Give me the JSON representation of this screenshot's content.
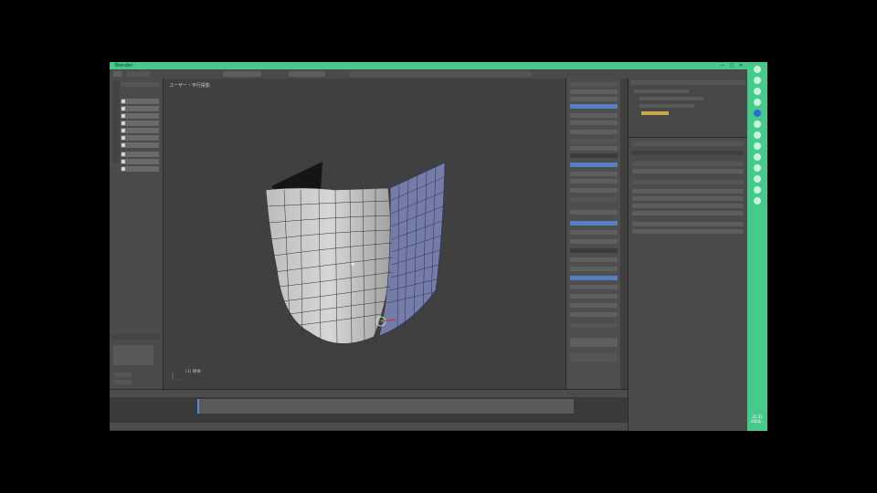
{
  "app": {
    "title": "Blender",
    "win_controls": [
      "—",
      "□",
      "✕"
    ]
  },
  "viewport": {
    "label": "ユーザー・平行投影",
    "corner_label": "(1) 球体"
  },
  "colors": {
    "accent_green": "#46c98a",
    "selected_blue": "#5680c2",
    "viewport_bg": "#404040"
  },
  "sidebar": {
    "clock": "22:31\n2020/..",
    "icons": [
      "circle-icon",
      "refresh-icon",
      "network-icon",
      "network-icon",
      "globe-icon",
      "cloud-icon",
      "folder-icon",
      "image-icon",
      "chat-icon",
      "settings-icon",
      "monitor-icon",
      "camera-icon",
      "gear-icon"
    ]
  }
}
